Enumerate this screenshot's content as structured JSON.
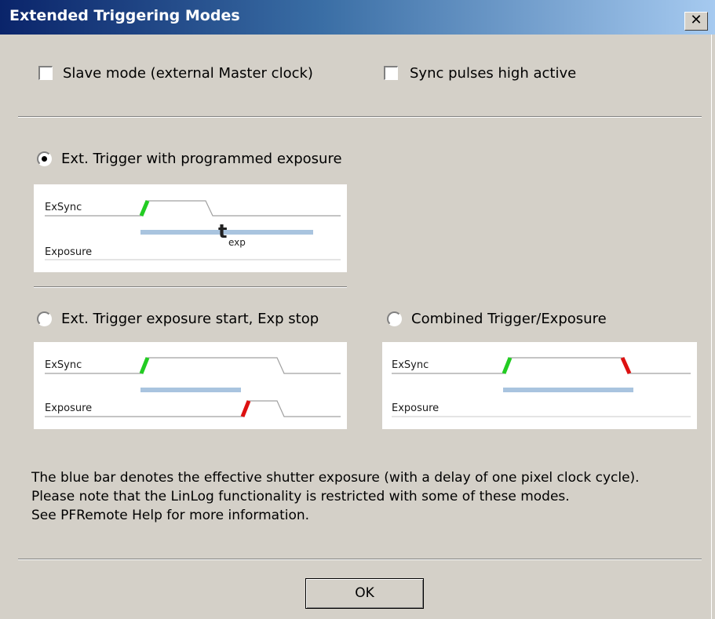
{
  "window": {
    "title": "Extended Triggering Modes",
    "close_glyph": "✕"
  },
  "options": {
    "slave_mode": {
      "label": "Slave mode (external Master clock)",
      "checked": false
    },
    "sync_high": {
      "label": "Sync pulses high active",
      "checked": false
    }
  },
  "modes": {
    "programmed": {
      "label": "Ext. Trigger with programmed exposure",
      "selected": true
    },
    "start_stop": {
      "label": "Ext. Trigger exposure start, Exp stop",
      "selected": false
    },
    "combined": {
      "label": "Combined Trigger/Exposure",
      "selected": false
    }
  },
  "diagrams": {
    "programmed": {
      "exsync_label": "ExSync",
      "exposure_label": "Exposure",
      "t_symbol": "t",
      "t_subscript": "exp"
    },
    "start_stop": {
      "exsync_label": "ExSync",
      "exposure_label": "Exposure"
    },
    "combined": {
      "exsync_label": "ExSync",
      "exposure_label": "Exposure"
    }
  },
  "colors": {
    "rising_edge": "#22cc22",
    "falling_edge": "#dd1111",
    "exposure_bar": "#a9c4df"
  },
  "note": {
    "line1": "The blue bar denotes the effective shutter exposure (with a delay of one pixel clock cycle).",
    "line2": "Please note that the LinLog functionality is restricted with some of these modes.",
    "line3": "See PFRemote Help for more information."
  },
  "buttons": {
    "ok": "OK"
  }
}
